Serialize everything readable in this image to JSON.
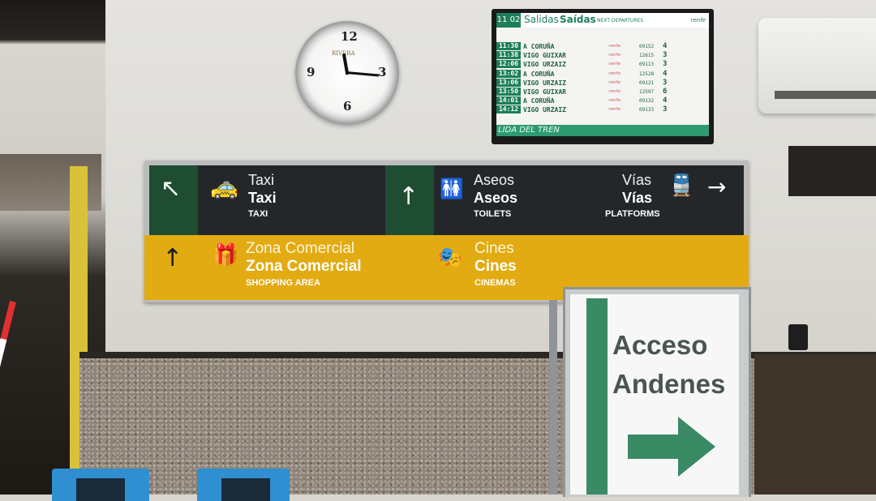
{
  "clock": {
    "numerals": [
      "12",
      "3",
      "6",
      "9"
    ],
    "brand": "RIVERA"
  },
  "departures_board": {
    "current_time": "11 02",
    "title_1": "Salidas",
    "title_2": "Saídas",
    "title_en": "NEXT DEPARTURES",
    "logo": "renfe",
    "rows": [
      {
        "time": "11:30",
        "destination": "A CORUÑA",
        "number": "09152",
        "platform": "4"
      },
      {
        "time": "11:38",
        "destination": "VIGO GUIXAR",
        "number": "12615",
        "platform": "3"
      },
      {
        "time": "12:06",
        "destination": "VIGO URZAIZ",
        "number": "09113",
        "platform": "3"
      },
      {
        "time": "13:02",
        "destination": "A CORUÑA",
        "number": "12528",
        "platform": "4"
      },
      {
        "time": "13:06",
        "destination": "VIGO URZAIZ",
        "number": "09121",
        "platform": "3"
      },
      {
        "time": "13:50",
        "destination": "VIGO GUIXAR",
        "number": "12597",
        "platform": "6"
      },
      {
        "time": "14:01",
        "destination": "A CORUÑA",
        "number": "09132",
        "platform": "4"
      },
      {
        "time": "14:12",
        "destination": "VIGO URZAIZ",
        "number": "09133",
        "platform": "3"
      }
    ],
    "operator": "renfe",
    "footer": "LIDA DEL TREN"
  },
  "sign": {
    "taxi": {
      "es_1": "Taxi",
      "es_2": "Taxi",
      "en": "TAXI",
      "arrow": "↖",
      "icon": "taxi-icon"
    },
    "aseos": {
      "es_1": "Aseos",
      "es_2": "Aseos",
      "en": "TOILETS",
      "arrow": "↑",
      "icon": "toilets-icon"
    },
    "vias": {
      "es_1": "Vías",
      "es_2": "Vías",
      "en": "PLATFORMS",
      "arrow": "→",
      "icon": "train-icon"
    },
    "zona": {
      "es_1": "Zona Comercial",
      "es_2": "Zona Comercial",
      "en": "SHOPPING AREA",
      "arrow": "↑",
      "icon": "gift-icon"
    },
    "cines": {
      "es_1": "Cines",
      "es_2": "Cines",
      "en": "CINEMAS",
      "icon": "cinema-icon"
    }
  },
  "access_sign": {
    "line_1": "Acceso",
    "line_2": "Andenes",
    "arrow": "right-arrow-icon"
  },
  "colors": {
    "sign_dark": "#23272a",
    "sign_green": "#1e4d32",
    "sign_yellow": "#e3ab12",
    "renfe_green": "#1d7f5a",
    "access_green": "#3a8a66"
  }
}
